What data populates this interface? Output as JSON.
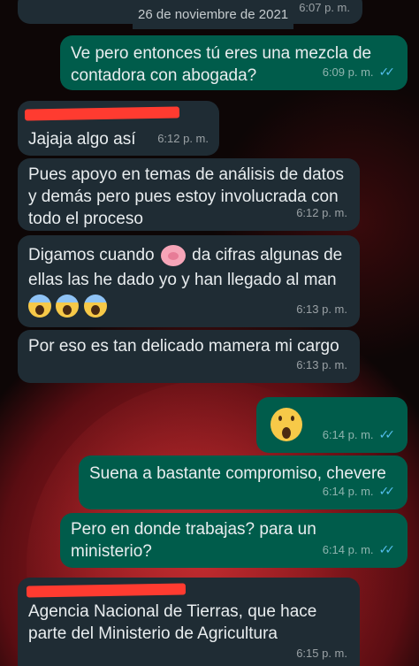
{
  "date_chip": "26 de noviembre de 2021",
  "messages": [
    {
      "id": "m0",
      "text": "",
      "time": "6:07 p. m."
    },
    {
      "id": "m1",
      "text_line1": "Ve pero entonces tú eres una mezcla de",
      "text_line2": "contadora con abogada?",
      "time": "6:09 p. m."
    },
    {
      "id": "m2",
      "text": "Jajaja algo así",
      "time": "6:12 p. m."
    },
    {
      "id": "m3",
      "text_line1": "Pues apoyo en temas de análisis de datos",
      "text_line2": "y demás pero pues estoy involucrada con",
      "text_line3": "todo el proceso",
      "time": "6:12 p. m."
    },
    {
      "id": "m4",
      "text_before": "Digamos cuando",
      "text_after": "da cifras algunas de",
      "text_line2": "ellas las he dado yo y han llegado al man",
      "time": "6:13 p. m."
    },
    {
      "id": "m5",
      "text": "Por eso es tan delicado mamera mi cargo",
      "time": "6:13 p. m."
    },
    {
      "id": "m6",
      "time": "6:14 p. m."
    },
    {
      "id": "m7",
      "text": "Suena a bastante compromiso, chevere",
      "time": "6:14 p. m."
    },
    {
      "id": "m8",
      "text_line1": "Pero en donde trabajas? para un",
      "text_line2": "ministerio?",
      "time": "6:14 p. m."
    },
    {
      "id": "m9",
      "text_line1": "Agencia Nacional de Tierras, que hace",
      "text_line2": "parte del Ministerio de Agricultura",
      "time": "6:15 p. m."
    }
  ],
  "ticks": "✓✓",
  "colors": {
    "incoming": "#1f2c34",
    "outgoing": "#005c4b",
    "read_ticks": "#53bdeb",
    "redaction": "#ff3b30"
  },
  "icons": [
    "pig-nose-emoji",
    "screaming-face-emoji",
    "astonished-face-emoji",
    "double-check-icon"
  ]
}
